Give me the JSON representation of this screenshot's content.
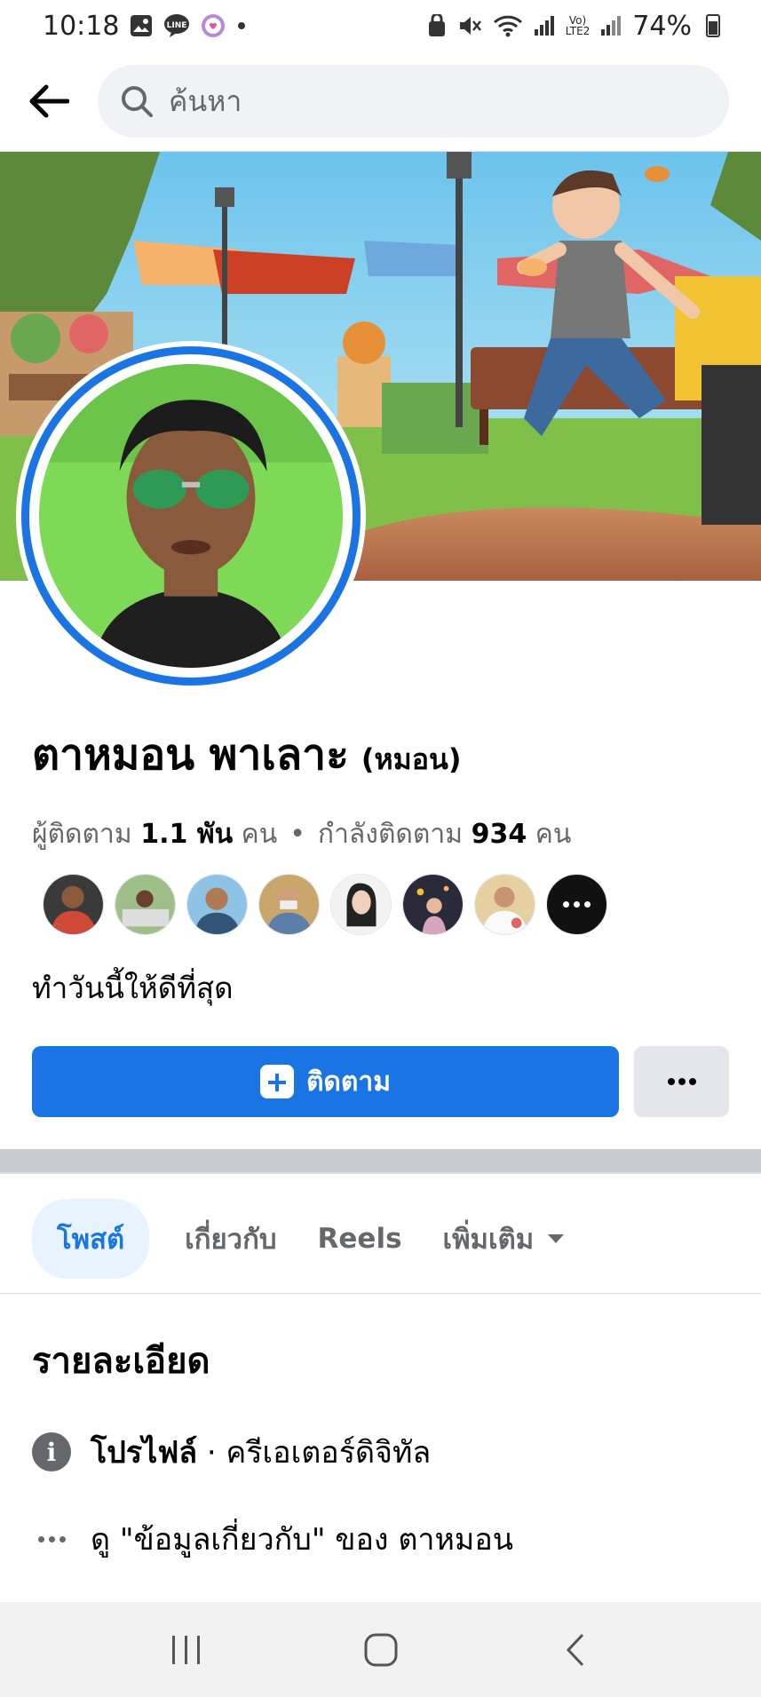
{
  "status_bar": {
    "time": "10:18",
    "battery": "74%",
    "network": "LTE2"
  },
  "search": {
    "placeholder": "ค้นหา"
  },
  "profile": {
    "name": "ตาหมอน พาเลาะ",
    "nickname": "(หมอน)",
    "followers_label": "ผู้ติดตาม",
    "followers_count": "1.1 พัน",
    "followers_unit": "คน",
    "separator": "•",
    "following_label": "กำลังติดตาม",
    "following_count": "934",
    "following_unit": "คน",
    "bio": "ทำวันนี้ให้ดีที่สุด",
    "friend_avatars": 7
  },
  "actions": {
    "follow_label": "ติดตาม"
  },
  "tabs": [
    {
      "label": "โพสต์",
      "active": true
    },
    {
      "label": "เกี่ยวกับ",
      "active": false
    },
    {
      "label": "Reels",
      "active": false
    },
    {
      "label": "เพิ่มเติม",
      "active": false
    }
  ],
  "details": {
    "title": "รายละเอียด",
    "profile_label": "โปรไฟล์",
    "profile_category": " · ครีเอเตอร์ดิจิทัล",
    "see_about": "ดู \"ข้อมูลเกี่ยวกับ\" ของ ตาหมอน"
  },
  "colors": {
    "accent": "#1b74e4",
    "tab_active_bg": "#e7f3ff",
    "secondary_text": "#65676b"
  }
}
